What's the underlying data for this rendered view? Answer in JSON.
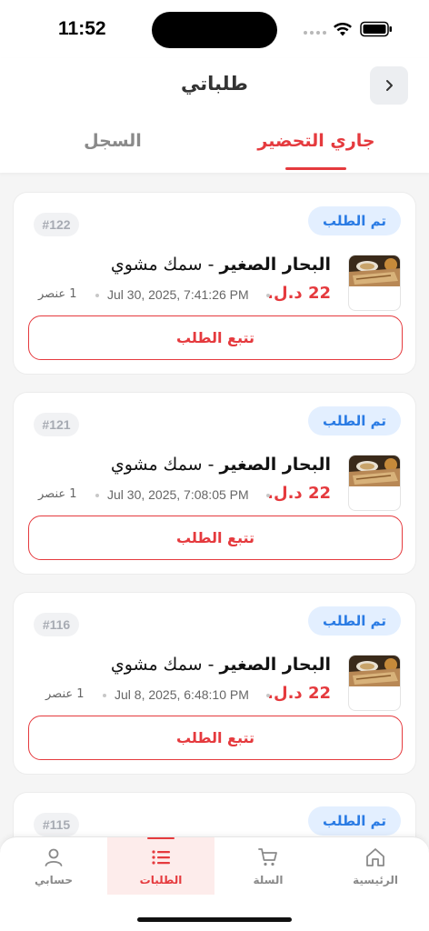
{
  "status_bar": {
    "time": "11:52"
  },
  "header": {
    "title": "طلباتي",
    "tabs": {
      "active": "جاري التحضير",
      "history": "السجل"
    }
  },
  "orders": [
    {
      "number": "#122",
      "status": "تم الطلب",
      "restaurant": "البحار الصغير",
      "separator": " - ",
      "item": "سمك مشوي",
      "price": "22 د.ل.",
      "date": "Jul 30, 2025, 7:41:26 PM",
      "count": "1 عنصر",
      "action": "تتبع الطلب"
    },
    {
      "number": "#121",
      "status": "تم الطلب",
      "restaurant": "البحار الصغير",
      "separator": " - ",
      "item": "سمك مشوي",
      "price": "22 د.ل.",
      "date": "Jul 30, 2025, 7:08:05 PM",
      "count": "1 عنصر",
      "action": "تتبع الطلب"
    },
    {
      "number": "#116",
      "status": "تم الطلب",
      "restaurant": "البحار الصغير",
      "separator": " - ",
      "item": "سمك مشوي",
      "price": "22 د.ل.",
      "date": "Jul 8, 2025, 6:48:10 PM",
      "count": "1 عنصر",
      "action": "تتبع الطلب"
    },
    {
      "number": "#115",
      "status": "تم الطلب"
    }
  ],
  "bottom_nav": {
    "home": "الرئيسية",
    "cart": "السلة",
    "orders": "الطلبات",
    "account": "حسابي"
  },
  "colors": {
    "accent": "#e53a3e",
    "badge_bg": "#e3efff",
    "badge_text": "#2a7be4"
  },
  "icons": [
    "back-chevron-icon",
    "home-icon",
    "cart-icon",
    "list-icon",
    "user-icon",
    "wifi-icon",
    "battery-icon"
  ]
}
